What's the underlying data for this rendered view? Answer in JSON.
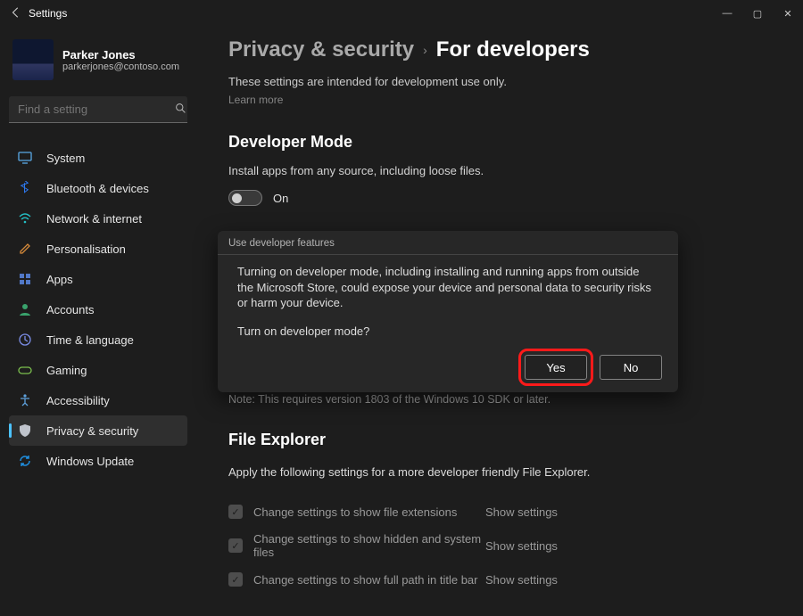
{
  "app_title": "Settings",
  "window_controls": {
    "min": "—",
    "max": "▢",
    "close": "✕"
  },
  "profile": {
    "name": "Parker Jones",
    "email": "parkerjones@contoso.com"
  },
  "search": {
    "placeholder": "Find a setting"
  },
  "sidebar": {
    "items": [
      {
        "icon": "monitor-icon",
        "label": "System",
        "color": "#5aa9e6"
      },
      {
        "icon": "bluetooth-icon",
        "label": "Bluetooth & devices",
        "color": "#2e7cf6"
      },
      {
        "icon": "wifi-icon",
        "label": "Network & internet",
        "color": "#24c0c6"
      },
      {
        "icon": "brush-icon",
        "label": "Personalisation",
        "color": "#d68a3a"
      },
      {
        "icon": "apps-icon",
        "label": "Apps",
        "color": "#5178c7"
      },
      {
        "icon": "accounts-icon",
        "label": "Accounts",
        "color": "#39a26c"
      },
      {
        "icon": "time-icon",
        "label": "Time & language",
        "color": "#7c8ee8"
      },
      {
        "icon": "gaming-icon",
        "label": "Gaming",
        "color": "#7bbf4e"
      },
      {
        "icon": "access-icon",
        "label": "Accessibility",
        "color": "#5fa2dd"
      },
      {
        "icon": "shield-icon",
        "label": "Privacy & security",
        "color": "#c0c4cc"
      },
      {
        "icon": "update-icon",
        "label": "Windows Update",
        "color": "#1f8fe0"
      }
    ],
    "selected_index": 9
  },
  "breadcrumb": {
    "parent": "Privacy & security",
    "chevron": "›",
    "current": "For developers"
  },
  "intro": {
    "desc": "These settings are intended for development use only.",
    "learn_more": "Learn more"
  },
  "dev_mode": {
    "heading": "Developer Mode",
    "sub": "Install apps from any source, including loose files.",
    "state_label": "On"
  },
  "dialog": {
    "title": "Use developer features",
    "para1": "Turning on developer mode, including installing and running apps from outside the Microsoft Store, could expose your device and personal data to security risks or harm your device.",
    "para2": "Turn on developer mode?",
    "yes": "Yes",
    "no": "No"
  },
  "note": "Note: This requires version 1803 of the Windows 10 SDK or later.",
  "file_explorer": {
    "heading": "File Explorer",
    "desc": "Apply the following settings for a more developer friendly File Explorer.",
    "action_label": "Show settings",
    "rows": [
      "Change settings to show file extensions",
      "Change settings to show hidden and system files",
      "Change settings to show full path in title bar"
    ]
  }
}
